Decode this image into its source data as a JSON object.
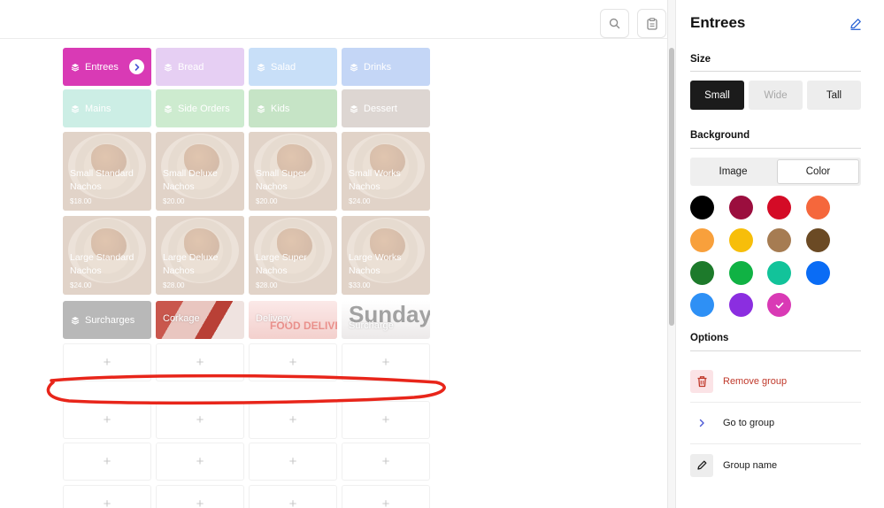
{
  "topbar": {
    "search_icon": "search-icon",
    "clipboard_icon": "clipboard-icon"
  },
  "grid": {
    "groups_row1": [
      {
        "label": "Entrees",
        "color": "#d93ab5",
        "active": true
      },
      {
        "label": "Bread",
        "color": "#e6cff3"
      },
      {
        "label": "Salad",
        "color": "#c8dff8"
      },
      {
        "label": "Drinks",
        "color": "#c4d6f6"
      }
    ],
    "groups_row2": [
      {
        "label": "Mains",
        "color": "#cceee5"
      },
      {
        "label": "Side Orders",
        "color": "#cdebcf"
      },
      {
        "label": "Kids",
        "color": "#c6e4c6"
      },
      {
        "label": "Dessert",
        "color": "#ddd6d2"
      }
    ],
    "food_row1": [
      {
        "name": "Small Standard Nachos",
        "price": "$18.00"
      },
      {
        "name": "Small Deluxe Nachos",
        "price": "$20.00"
      },
      {
        "name": "Small Super Nachos",
        "price": "$20.00"
      },
      {
        "name": "Small Works Nachos",
        "price": "$24.00"
      }
    ],
    "food_row2": [
      {
        "name": "Large Standard Nachos",
        "price": "$24.00"
      },
      {
        "name": "Large Deluxe Nachos",
        "price": "$28.00"
      },
      {
        "name": "Large Super Nachos",
        "price": "$28.00"
      },
      {
        "name": "Large Works Nachos",
        "price": "$33.00"
      }
    ],
    "row5": [
      {
        "label": "Surcharges",
        "color": "#b8b8b8"
      },
      {
        "label": "Corkage"
      },
      {
        "label": "Delivery",
        "overlay": "FOOD DELIVERY"
      },
      {
        "label": "Surcharge",
        "overlay": "Sunday!"
      }
    ],
    "empty_symbol": "+"
  },
  "panel": {
    "title": "Entrees",
    "size_title": "Size",
    "sizes": [
      "Small",
      "Wide",
      "Tall"
    ],
    "background_title": "Background",
    "bg_options": [
      "Image",
      "Color"
    ],
    "swatches": [
      "#000000",
      "#9b0e3e",
      "#d40b26",
      "#f5673c",
      "#f8a03c",
      "#f7be0a",
      "#a67c52",
      "#6b4a24",
      "#1d7a2b",
      "#10b244",
      "#12c39a",
      "#0a6cf5",
      "#2e90f5",
      "#8b2ee0",
      "#d93ab5"
    ],
    "selected_swatch": "#d93ab5",
    "options_title": "Options",
    "options": [
      {
        "label": "Remove group",
        "icon": "trash-icon",
        "color": "#c0392b"
      },
      {
        "label": "Go to group",
        "icon": "chevron-right-icon",
        "color": "#1a1a1a"
      },
      {
        "label": "Group name",
        "icon": "pencil-icon",
        "color": "#1a1a1a"
      }
    ]
  }
}
